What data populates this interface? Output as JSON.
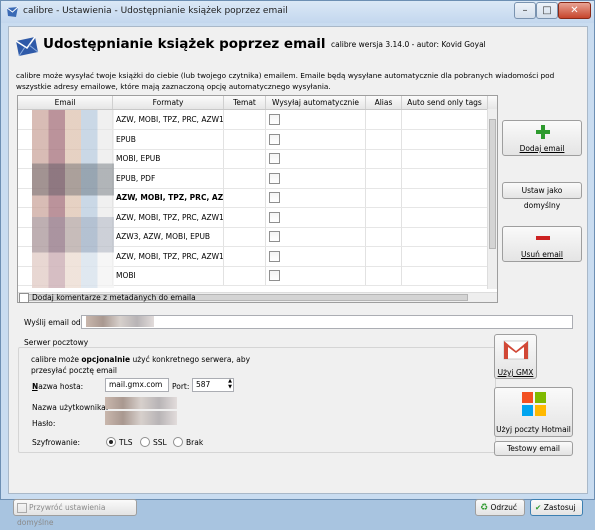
{
  "window": {
    "title": "calibre - Ustawienia - Udostępnianie książek poprzez email",
    "minimize": "–",
    "maximize": "□",
    "close": "✕"
  },
  "header": {
    "title": "Udostępnianie książek poprzez email",
    "version": "calibre wersja 3.14.0 - autor: Kovid Goyal"
  },
  "description": "calibre może wysyłać twoje książki do ciebie (lub twojego czytnika) emailem. Emaile będą wysyłane automatycznie dla pobranych wiadomości pod wszystkie adresy emailowe, które mają zaznaczoną opcję automatycznego wysyłania.",
  "table": {
    "columns": [
      "Email",
      "Formaty",
      "Temat",
      "Wysyłaj automatycznie",
      "Alias",
      "Auto send only tags"
    ],
    "rows": [
      {
        "formats": "AZW, MOBI, TPZ, PRC, AZW1",
        "bold": false
      },
      {
        "formats": "EPUB",
        "bold": false
      },
      {
        "formats": "MOBI, EPUB",
        "bold": false
      },
      {
        "formats": "EPUB, PDF",
        "bold": false
      },
      {
        "formats": "AZW, MOBI, TPZ, PRC, AZW1",
        "bold": true
      },
      {
        "formats": "AZW, MOBI, TPZ, PRC, AZW1",
        "bold": false
      },
      {
        "formats": "AZW3, AZW, MOBI, EPUB",
        "bold": false
      },
      {
        "formats": "AZW, MOBI, TPZ, PRC, AZW1",
        "bold": false
      },
      {
        "formats": "MOBI",
        "bold": false
      }
    ]
  },
  "side_buttons": {
    "add": "Dodaj email",
    "set_default": "Ustaw jako domyślny",
    "remove": "Usuń email"
  },
  "add_comments_label": "Dodaj komentarze z metadanych do emaila",
  "send_from_label": "Wyślij email od:",
  "server": {
    "group_title": "Serwer pocztowy",
    "desc_pre": "calibre może ",
    "desc_bold": "opcjonalnie",
    "desc_post": " użyć konkretnego serwera, aby przesyłać pocztę email",
    "host_label": "Nazwa hosta:",
    "host_value": "mail.gmx.com",
    "port_label": "Port:",
    "port_value": "587",
    "user_label": "Nazwa użytkownika:",
    "password_label": "Hasło:",
    "encryption_label": "Szyfrowanie:",
    "encryption_options": [
      "TLS",
      "SSL",
      "Brak"
    ],
    "encryption_selected": "TLS"
  },
  "provider_buttons": {
    "gmx": "Użyj GMX",
    "hotmail": "Użyj poczty Hotmail",
    "test": "Testowy email"
  },
  "footer": {
    "restore_defaults": "Przywróć ustawienia domyślne",
    "discard": "Odrzuć",
    "apply": "Zastosuj"
  },
  "colors": {
    "add_green": "#2e9a2e",
    "remove_red": "#cc2222",
    "gmx_red": "#d14836",
    "titlebar": "#c9dcf0"
  }
}
